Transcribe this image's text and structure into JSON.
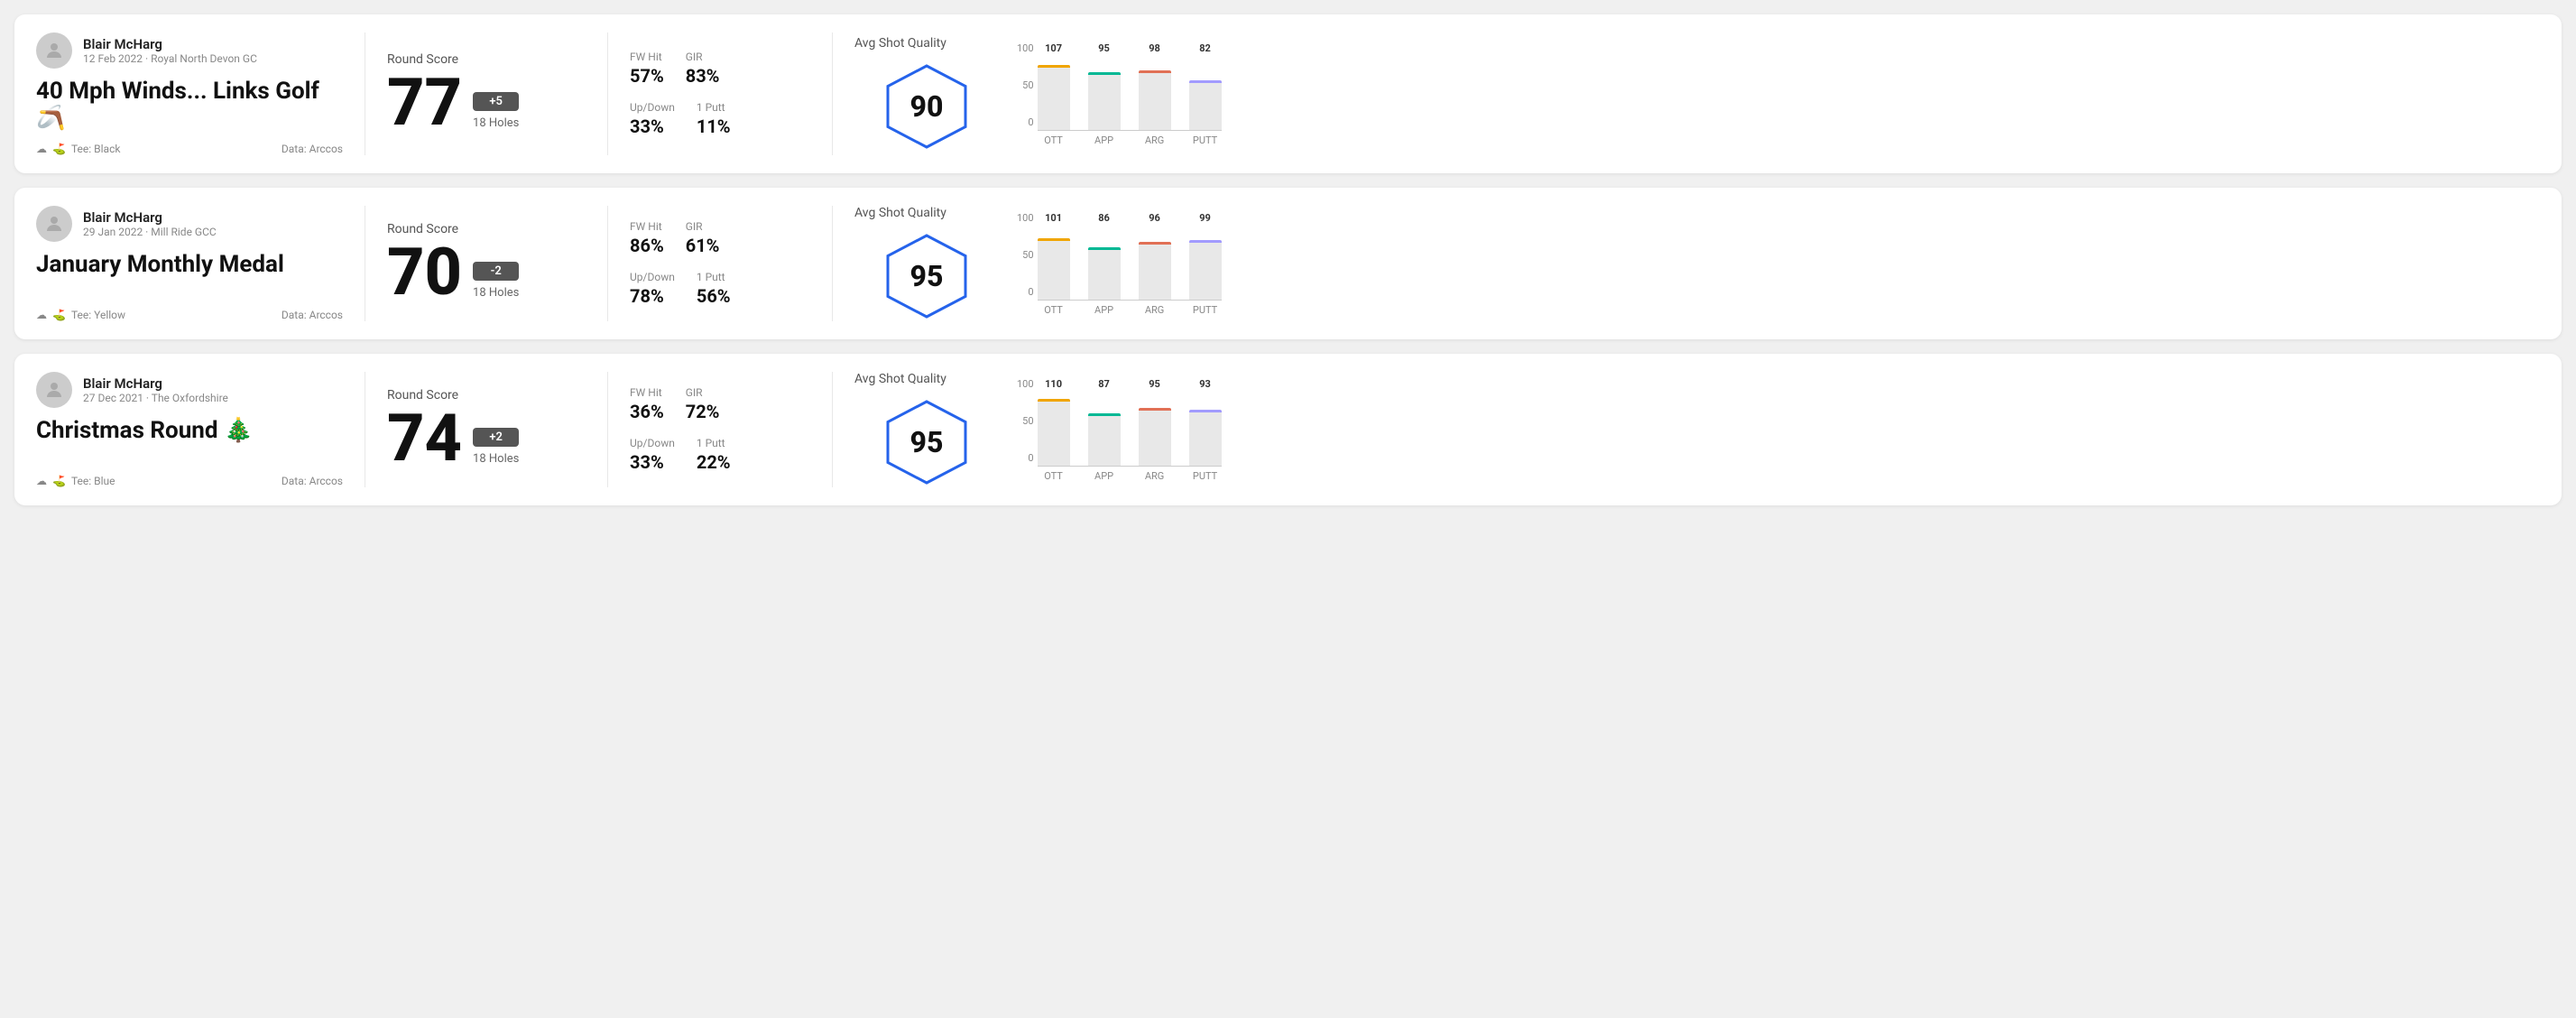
{
  "rounds": [
    {
      "id": "round-1",
      "user": {
        "name": "Blair McHarg",
        "date": "12 Feb 2022",
        "course": "Royal North Devon GC"
      },
      "title": "40 Mph Winds... Links Golf",
      "title_emoji": "🪃",
      "tee": "Black",
      "data_source": "Data: Arccos",
      "score": {
        "label": "Round Score",
        "value": "77",
        "modifier": "+5",
        "modifier_type": "positive",
        "holes": "18 Holes"
      },
      "stats": {
        "fw_hit_label": "FW Hit",
        "fw_hit_value": "57%",
        "gir_label": "GIR",
        "gir_value": "83%",
        "updown_label": "Up/Down",
        "updown_value": "33%",
        "oneputt_label": "1 Putt",
        "oneputt_value": "11%"
      },
      "quality": {
        "label": "Avg Shot Quality",
        "score": "90"
      },
      "chart": {
        "bars": [
          {
            "label": "OTT",
            "value": 107,
            "color": "#f0a500"
          },
          {
            "label": "APP",
            "value": 95,
            "color": "#00b894"
          },
          {
            "label": "ARG",
            "value": 98,
            "color": "#e17055"
          },
          {
            "label": "PUTT",
            "value": 82,
            "color": "#a29bfe"
          }
        ],
        "y_labels": [
          "100",
          "50",
          "0"
        ]
      }
    },
    {
      "id": "round-2",
      "user": {
        "name": "Blair McHarg",
        "date": "29 Jan 2022",
        "course": "Mill Ride GCC"
      },
      "title": "January Monthly Medal",
      "title_emoji": "",
      "tee": "Yellow",
      "data_source": "Data: Arccos",
      "score": {
        "label": "Round Score",
        "value": "70",
        "modifier": "-2",
        "modifier_type": "negative",
        "holes": "18 Holes"
      },
      "stats": {
        "fw_hit_label": "FW Hit",
        "fw_hit_value": "86%",
        "gir_label": "GIR",
        "gir_value": "61%",
        "updown_label": "Up/Down",
        "updown_value": "78%",
        "oneputt_label": "1 Putt",
        "oneputt_value": "56%"
      },
      "quality": {
        "label": "Avg Shot Quality",
        "score": "95"
      },
      "chart": {
        "bars": [
          {
            "label": "OTT",
            "value": 101,
            "color": "#f0a500"
          },
          {
            "label": "APP",
            "value": 86,
            "color": "#00b894"
          },
          {
            "label": "ARG",
            "value": 96,
            "color": "#e17055"
          },
          {
            "label": "PUTT",
            "value": 99,
            "color": "#a29bfe"
          }
        ],
        "y_labels": [
          "100",
          "50",
          "0"
        ]
      }
    },
    {
      "id": "round-3",
      "user": {
        "name": "Blair McHarg",
        "date": "27 Dec 2021",
        "course": "The Oxfordshire"
      },
      "title": "Christmas Round",
      "title_emoji": "🎄",
      "tee": "Blue",
      "data_source": "Data: Arccos",
      "score": {
        "label": "Round Score",
        "value": "74",
        "modifier": "+2",
        "modifier_type": "positive",
        "holes": "18 Holes"
      },
      "stats": {
        "fw_hit_label": "FW Hit",
        "fw_hit_value": "36%",
        "gir_label": "GIR",
        "gir_value": "72%",
        "updown_label": "Up/Down",
        "updown_value": "33%",
        "oneputt_label": "1 Putt",
        "oneputt_value": "22%"
      },
      "quality": {
        "label": "Avg Shot Quality",
        "score": "95"
      },
      "chart": {
        "bars": [
          {
            "label": "OTT",
            "value": 110,
            "color": "#f0a500"
          },
          {
            "label": "APP",
            "value": 87,
            "color": "#00b894"
          },
          {
            "label": "ARG",
            "value": 95,
            "color": "#e17055"
          },
          {
            "label": "PUTT",
            "value": 93,
            "color": "#a29bfe"
          }
        ],
        "y_labels": [
          "100",
          "50",
          "0"
        ]
      }
    }
  ]
}
